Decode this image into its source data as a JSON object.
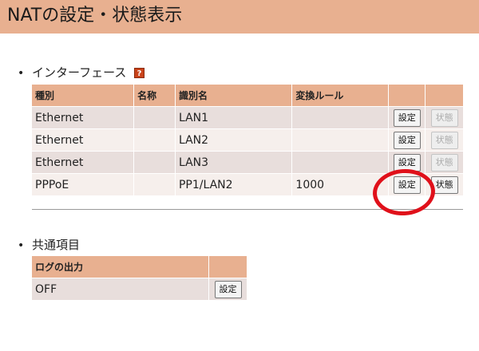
{
  "header": {
    "title": "NATの設定・状態表示"
  },
  "interfaces": {
    "heading": "インターフェース",
    "help_icon": "?",
    "columns": [
      "種別",
      "名称",
      "識別名",
      "変換ルール",
      "",
      ""
    ],
    "rows": [
      {
        "type": "Ethernet",
        "name": "",
        "id": "LAN1",
        "rule": "",
        "setting": "設定",
        "status": "状態",
        "status_enabled": false
      },
      {
        "type": "Ethernet",
        "name": "",
        "id": "LAN2",
        "rule": "",
        "setting": "設定",
        "status": "状態",
        "status_enabled": false
      },
      {
        "type": "Ethernet",
        "name": "",
        "id": "LAN3",
        "rule": "",
        "setting": "設定",
        "status": "状態",
        "status_enabled": false
      },
      {
        "type": "PPPoE",
        "name": "",
        "id": "PP1/LAN2",
        "rule": "1000",
        "setting": "設定",
        "status": "状態",
        "status_enabled": true
      }
    ]
  },
  "common": {
    "heading": "共通項目",
    "columns": [
      "ログの出力",
      ""
    ],
    "rows": [
      {
        "value": "OFF",
        "setting": "設定"
      }
    ]
  },
  "annotation": {
    "color": "#e0101a"
  }
}
